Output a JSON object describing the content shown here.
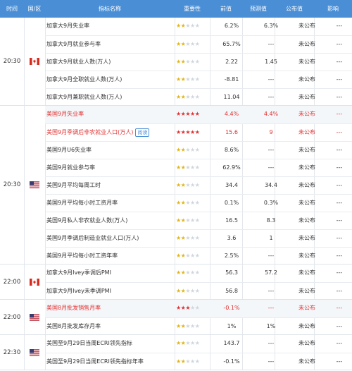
{
  "header": {
    "time": "时间",
    "region": "国/区",
    "indicator": "指标名称",
    "importance": "重要性",
    "previous": "前值",
    "forecast": "预测值",
    "published": "公布值",
    "impact": "影响"
  },
  "read_label": "阅读",
  "groups": [
    {
      "time": "20:30",
      "flag": "canada-flag-icon",
      "rows": [
        {
          "name": "加拿大9月失业率",
          "stars": 2,
          "prev": "6.2%",
          "fc": "6.3%",
          "pub": "未公布",
          "imp": "---"
        },
        {
          "name": "加拿大9月就业参与率",
          "stars": 2,
          "prev": "65.7%",
          "fc": "---",
          "pub": "未公布",
          "imp": "---"
        },
        {
          "name": "加拿大9月就业人数(万人)",
          "stars": 2,
          "prev": "2.22",
          "fc": "1.45",
          "pub": "未公布",
          "imp": "---"
        },
        {
          "name": "加拿大9月全职就业人数(万人)",
          "stars": 2,
          "prev": "-8.81",
          "fc": "---",
          "pub": "未公布",
          "imp": "---"
        },
        {
          "name": "加拿大9月兼职就业人数(万人)",
          "stars": 2,
          "prev": "11.04",
          "fc": "---",
          "pub": "未公布",
          "imp": "---"
        }
      ]
    },
    {
      "time": "20:30",
      "flag": "usa-flag-icon",
      "rows": [
        {
          "name": "美国9月失业率",
          "stars": 5,
          "prev": "4.4%",
          "fc": "4.4%",
          "pub": "未公布",
          "imp": "---",
          "red": true,
          "hl": true
        },
        {
          "name": "美国9月季调后非农就业人口(万人)",
          "stars": 5,
          "prev": "15.6",
          "fc": "9",
          "pub": "未公布",
          "imp": "---",
          "red": true,
          "read": true
        },
        {
          "name": "美国9月U6失业率",
          "stars": 2,
          "prev": "8.6%",
          "fc": "---",
          "pub": "未公布",
          "imp": "---"
        },
        {
          "name": "美国9月就业参与率",
          "stars": 2,
          "prev": "62.9%",
          "fc": "---",
          "pub": "未公布",
          "imp": "---"
        },
        {
          "name": "美国9月平均每周工时",
          "stars": 2,
          "prev": "34.4",
          "fc": "34.4",
          "pub": "未公布",
          "imp": "---"
        },
        {
          "name": "美国9月平均每小时工资月率",
          "stars": 2,
          "prev": "0.1%",
          "fc": "0.3%",
          "pub": "未公布",
          "imp": "---"
        },
        {
          "name": "美国9月私人非农就业人数(万人)",
          "stars": 2,
          "prev": "16.5",
          "fc": "8.3",
          "pub": "未公布",
          "imp": "---"
        },
        {
          "name": "美国9月季调后制造业就业人口(万人)",
          "stars": 2,
          "prev": "3.6",
          "fc": "1",
          "pub": "未公布",
          "imp": "---"
        },
        {
          "name": "美国9月平均每小时工资年率",
          "stars": 2,
          "prev": "2.5%",
          "fc": "---",
          "pub": "未公布",
          "imp": "---"
        }
      ]
    },
    {
      "time": "22:00",
      "flag": "canada-flag-icon",
      "rows": [
        {
          "name": "加拿大9月Ivey季调后PMI",
          "stars": 2,
          "prev": "56.3",
          "fc": "57.2",
          "pub": "未公布",
          "imp": "---"
        },
        {
          "name": "加拿大9月Ivey未季调PMI",
          "stars": 2,
          "prev": "56.8",
          "fc": "---",
          "pub": "未公布",
          "imp": "---"
        }
      ]
    },
    {
      "time": "22:00",
      "flag": "usa-flag-icon",
      "rows": [
        {
          "name": "美国8月批发销售月率",
          "stars": 3,
          "prev": "-0.1%",
          "fc": "---",
          "pub": "未公布",
          "imp": "---",
          "red": true,
          "hl": true
        },
        {
          "name": "美国8月批发库存月率",
          "stars": 2,
          "prev": "1%",
          "fc": "1%",
          "pub": "未公布",
          "imp": "---"
        }
      ]
    },
    {
      "time": "22:30",
      "flag": "usa-flag-icon",
      "rows": [
        {
          "name": "美国至9月29日当周ECRI领先指标",
          "stars": 2,
          "prev": "143.7",
          "fc": "---",
          "pub": "未公布",
          "imp": "---"
        },
        {
          "name": "美国至9月29日当周ECRI领先指标年率",
          "stars": 2,
          "prev": "-0.1%",
          "fc": "---",
          "pub": "未公布",
          "imp": "---"
        }
      ]
    }
  ]
}
